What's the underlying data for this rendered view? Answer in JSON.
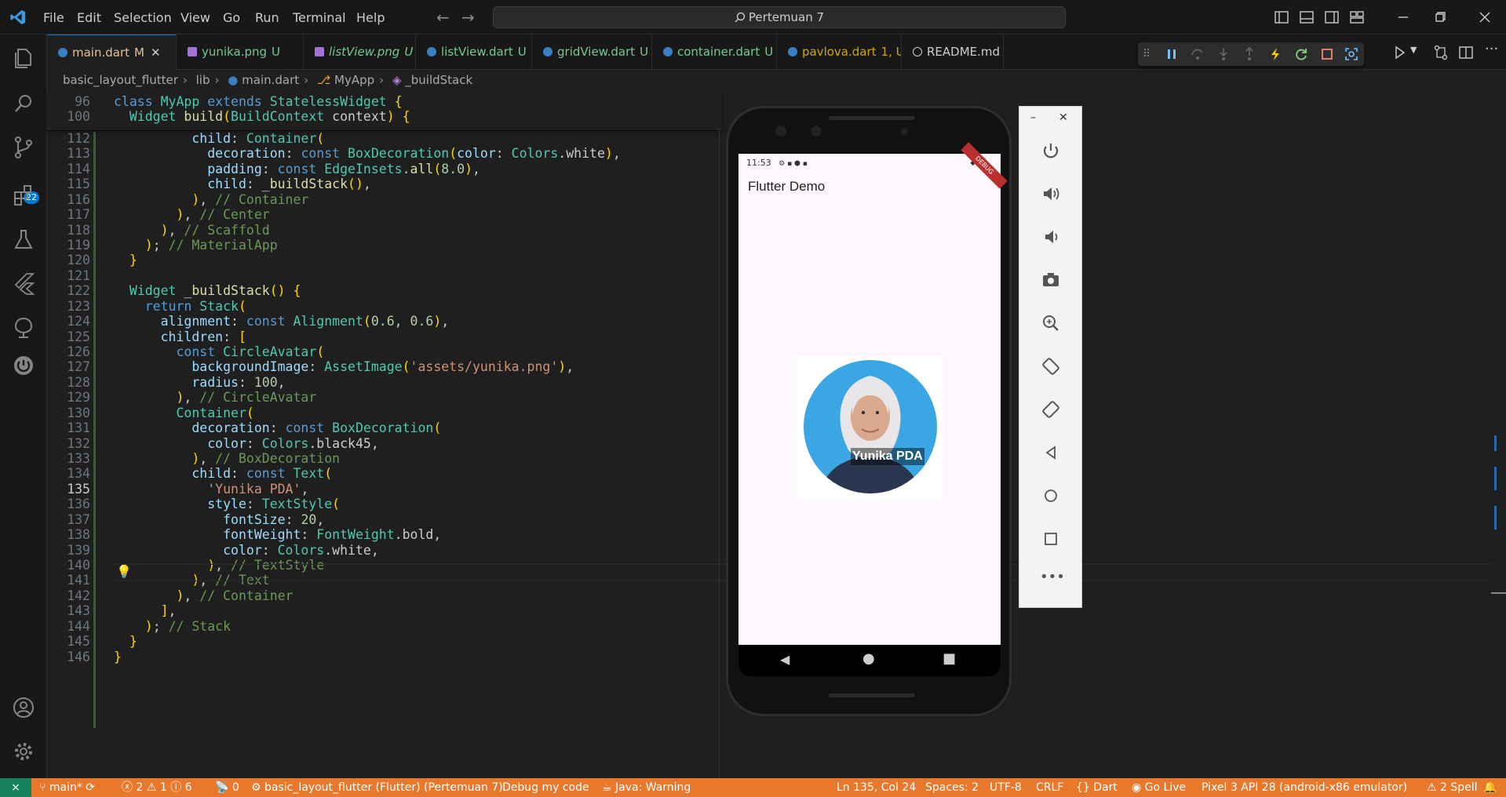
{
  "menu": [
    "File",
    "Edit",
    "Selection",
    "View",
    "Go",
    "Run",
    "Terminal",
    "Help"
  ],
  "command_center": "Pertemuan 7",
  "tabs": [
    {
      "label": "main.dart",
      "status": "M",
      "active": true,
      "kind": "dart"
    },
    {
      "label": "yunika.png",
      "status": "U",
      "kind": "img"
    },
    {
      "label": "listView.png",
      "status": "U",
      "kind": "img"
    },
    {
      "label": "listView.dart",
      "status": "U",
      "kind": "dart"
    },
    {
      "label": "gridView.dart",
      "status": "U",
      "kind": "dart"
    },
    {
      "label": "container.dart",
      "status": "U",
      "kind": "dart"
    },
    {
      "label": "pavlova.dart",
      "status": "1, U",
      "kind": "dart"
    },
    {
      "label": "README.md",
      "status": "",
      "kind": "md"
    }
  ],
  "activity_badge": "22",
  "breadcrumb": [
    "basic_layout_flutter",
    "lib",
    "main.dart",
    "MyApp",
    "_buildStack"
  ],
  "sticky_lines": [
    {
      "n": "96",
      "code": "class MyApp extends StatelessWidget {"
    },
    {
      "n": "100",
      "code": "  Widget build(BuildContext context) {"
    }
  ],
  "lines": [
    {
      "n": "112",
      "code": "          child: Container("
    },
    {
      "n": "113",
      "code": "            decoration: const BoxDecoration(color: Colors.white),"
    },
    {
      "n": "114",
      "code": "            padding: const EdgeInsets.all(8.0),"
    },
    {
      "n": "115",
      "code": "            child: _buildStack(),"
    },
    {
      "n": "116",
      "code": "          ), // Container"
    },
    {
      "n": "117",
      "code": "        ), // Center"
    },
    {
      "n": "118",
      "code": "      ), // Scaffold"
    },
    {
      "n": "119",
      "code": "    ); // MaterialApp"
    },
    {
      "n": "120",
      "code": "  }"
    },
    {
      "n": "121",
      "code": ""
    },
    {
      "n": "122",
      "code": "  Widget _buildStack() {"
    },
    {
      "n": "123",
      "code": "    return Stack("
    },
    {
      "n": "124",
      "code": "      alignment: const Alignment(0.6, 0.6),"
    },
    {
      "n": "125",
      "code": "      children: ["
    },
    {
      "n": "126",
      "code": "        const CircleAvatar("
    },
    {
      "n": "127",
      "code": "          backgroundImage: AssetImage('assets/yunika.png'),"
    },
    {
      "n": "128",
      "code": "          radius: 100,"
    },
    {
      "n": "129",
      "code": "        ), // CircleAvatar"
    },
    {
      "n": "130",
      "code": "        Container("
    },
    {
      "n": "131",
      "code": "          decoration: const BoxDecoration("
    },
    {
      "n": "132",
      "code": "            color: Colors.black45,"
    },
    {
      "n": "133",
      "code": "          ), // BoxDecoration"
    },
    {
      "n": "134",
      "code": "          child: const Text("
    },
    {
      "n": "135",
      "code": "            'Yunika PDA',"
    },
    {
      "n": "136",
      "code": "            style: TextStyle("
    },
    {
      "n": "137",
      "code": "              fontSize: 20,"
    },
    {
      "n": "138",
      "code": "              fontWeight: FontWeight.bold,"
    },
    {
      "n": "139",
      "code": "              color: Colors.white,"
    },
    {
      "n": "140",
      "code": "            ), // TextStyle"
    },
    {
      "n": "141",
      "code": "          ), // Text"
    },
    {
      "n": "142",
      "code": "        ), // Container"
    },
    {
      "n": "143",
      "code": "      ],"
    },
    {
      "n": "144",
      "code": "    ); // Stack"
    },
    {
      "n": "145",
      "code": "  }"
    },
    {
      "n": "146",
      "code": "}"
    }
  ],
  "emulator": {
    "time": "11:53",
    "app_title": "Flutter Demo",
    "debug_banner": "DEBUG",
    "avatar_label": "Yunika PDA"
  },
  "statusbar": {
    "branch": "main*",
    "errors": "2",
    "warnings": "1",
    "infos": "6",
    "ports": "0",
    "launch": "basic_layout_flutter (Flutter) (Pertemuan 7)",
    "debug_my_code": "Debug my code",
    "java": "Java: Warning",
    "position": "Ln 135, Col 24",
    "spaces": "Spaces: 2",
    "encoding": "UTF-8",
    "eol": "CRLF",
    "language": "Dart",
    "golive": "Go Live",
    "device": "Pixel 3 API 28 (android-x86 emulator)",
    "spell": "2 Spell"
  },
  "colors": {
    "accent": "#0078d4",
    "statusbar": "#e8782b",
    "remote": "#16825d"
  }
}
